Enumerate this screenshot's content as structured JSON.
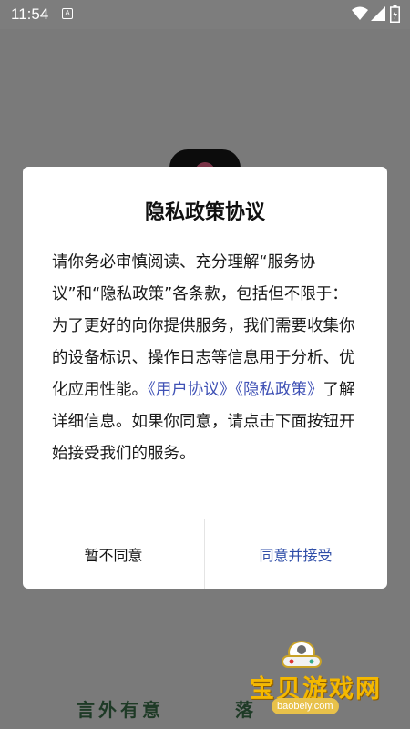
{
  "status_bar": {
    "time": "11:54",
    "notification_letter": "A",
    "icons": [
      "wifi-icon",
      "signal-icon",
      "battery-icon"
    ]
  },
  "background": {
    "bottom_texts": [
      "言外有意",
      "落"
    ]
  },
  "dialog": {
    "title": "隐私政策协议",
    "body_intro": "请你务必审慎阅读、充分理解“服务协议”和“隐私政策”各条款，包括但不限于：为了更好的向你提供服务，我们需要收集你的设备标识、操作日志等信息用于分析、优化应用性能。",
    "link_user_agreement": "《用户协议》",
    "link_privacy_policy": "《隐私政策》",
    "body_outro": "了解详细信息。如果你同意，请点击下面按钮开始接受我们的服务。",
    "decline_label": "暂不同意",
    "accept_label": "同意并接受"
  },
  "watermark": {
    "name": "宝贝游戏网",
    "url": "baobeiy.com"
  },
  "colors": {
    "overlay_background": "#7a7a7a",
    "link": "#3f51b5",
    "accept_button": "#2f4ea8",
    "watermark_text": "#f4b800"
  }
}
